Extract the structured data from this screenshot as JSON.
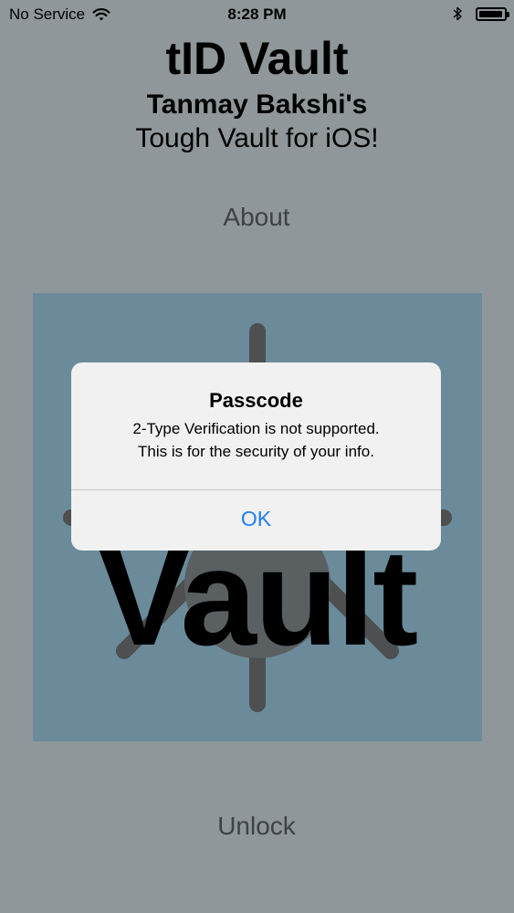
{
  "status_bar": {
    "carrier": "No Service",
    "time": "8:28 PM",
    "wifi_icon": "wifi-icon",
    "bluetooth_icon": "bluetooth-icon",
    "battery_icon": "battery-icon",
    "battery_level": 0.95
  },
  "header": {
    "title": "tID Vault",
    "subtitle": "Tanmay Bakshi's",
    "tagline": "Tough Vault for iOS!"
  },
  "about_button": {
    "label": "About"
  },
  "logo": {
    "word": "Vault",
    "dial_icon": "vault-dial-icon",
    "panel_color": "#6b8b9b"
  },
  "unlock_button": {
    "label": "Unlock"
  },
  "alert": {
    "title": "Passcode",
    "message_line1": "2-Type Verification is not supported.",
    "message_line2": "This is for the security of your info.",
    "ok_label": "OK",
    "ok_color": "#1f7ef0"
  }
}
